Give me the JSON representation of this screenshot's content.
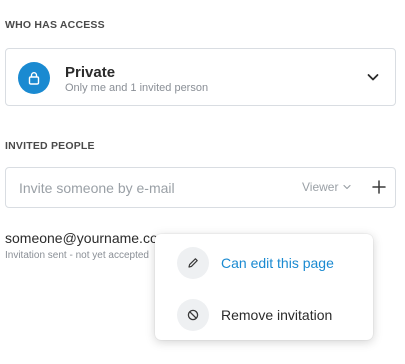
{
  "access": {
    "heading": "WHO HAS ACCESS",
    "title": "Private",
    "subtitle": "Only me and 1 invited person"
  },
  "invited": {
    "heading": "INVITED PEOPLE",
    "input_placeholder": "Invite someone by e-mail",
    "role_value": "Viewer"
  },
  "invitee": {
    "email": "someone@yourname.com",
    "status": "Invitation sent - not yet accepted"
  },
  "menu": {
    "items": [
      {
        "label": "Can edit this page",
        "icon": "pencil-icon"
      },
      {
        "label": "Remove invitation",
        "icon": "block-icon"
      }
    ]
  },
  "colors": {
    "accent": "#1a8ad1",
    "border": "#d9dde2",
    "muted": "#8a8f96"
  }
}
